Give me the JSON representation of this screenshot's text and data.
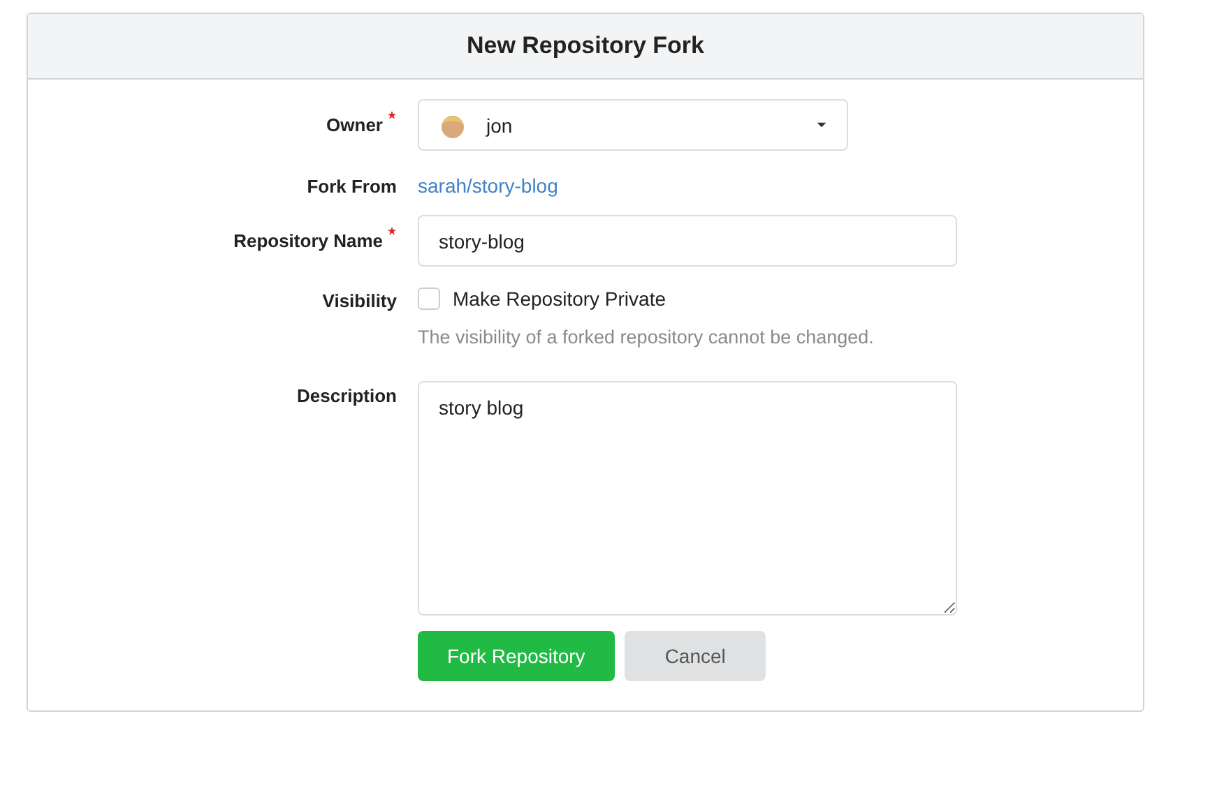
{
  "title": "New Repository Fork",
  "owner": {
    "label": "Owner",
    "required": true,
    "value": "jon"
  },
  "fork_from": {
    "label": "Fork From",
    "link": "sarah/story-blog"
  },
  "repository_name": {
    "label": "Repository Name",
    "required": true,
    "value": "story-blog"
  },
  "visibility": {
    "label": "Visibility",
    "checkbox_label": "Make Repository Private",
    "checked": false,
    "help": "The visibility of a forked repository cannot be changed."
  },
  "description": {
    "label": "Description",
    "value": "story blog"
  },
  "buttons": [
    {
      "label": "Fork Repository",
      "kind": "primary"
    },
    {
      "label": "Cancel",
      "kind": "secondary"
    }
  ]
}
